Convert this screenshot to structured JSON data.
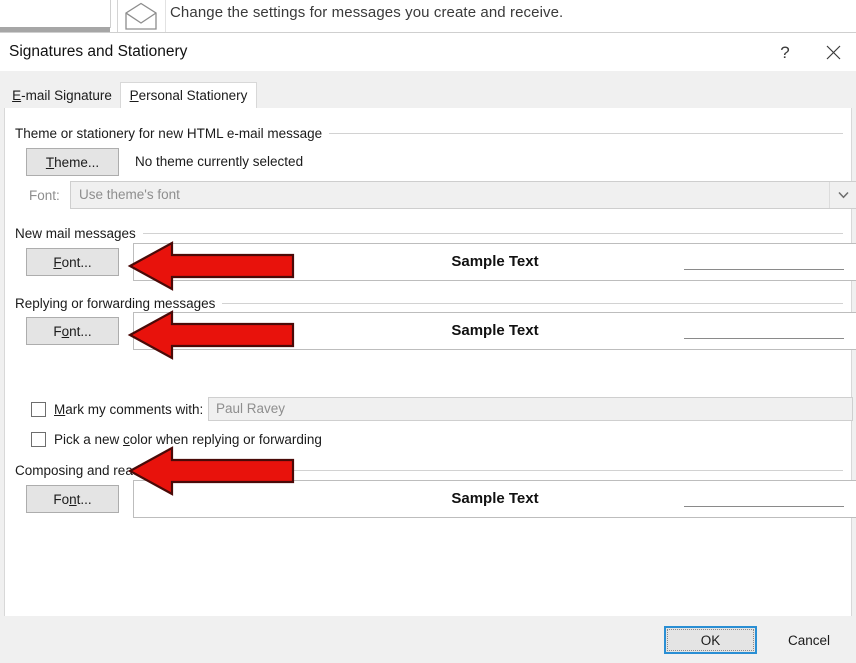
{
  "background": {
    "caption": "Change the settings for messages you create and receive.",
    "envelope_icon": "envelope-icon"
  },
  "dialog": {
    "title": "Signatures and Stationery",
    "help_glyph": "?",
    "close_glyph": "✕",
    "tabs": [
      {
        "label_pre": "",
        "accel": "E",
        "label_post": "-mail Signature",
        "active": false
      },
      {
        "label_pre": "",
        "accel": "P",
        "label_post": "ersonal Stationery",
        "active": true
      }
    ],
    "groups": {
      "theme": {
        "label": "Theme or stationery for new HTML e-mail message",
        "button_pre": "",
        "button_accel": "T",
        "button_post": "heme...",
        "status": "No theme currently selected",
        "font_label": "Font:",
        "font_value": "Use theme's font",
        "font_dropdown_icon": "chevron-down-icon"
      },
      "new_mail": {
        "label": "New mail messages",
        "button_pre": "",
        "button_accel": "F",
        "button_post": "ont...",
        "sample_text": "Sample Text"
      },
      "reply_forward": {
        "label": "Replying or forwarding messages",
        "button_pre": "F",
        "button_accel": "o",
        "button_post": "nt...",
        "sample_text": "Sample Text"
      },
      "plain_text": {
        "label": "Composing and reading plain text messages",
        "button_pre": "Fo",
        "button_accel": "n",
        "button_post": "t...",
        "sample_text": "Sample Text"
      }
    },
    "checkboxes": [
      {
        "label_pre": "",
        "accel": "M",
        "label_post": "ark my comments with:",
        "checked": false,
        "field_value": "Paul Ravey"
      },
      {
        "label_pre": "Pick a new ",
        "accel": "c",
        "label_post": "olor when replying or forwarding",
        "checked": false
      }
    ],
    "footer": {
      "ok_label": "OK",
      "cancel_label": "Cancel"
    }
  },
  "annotations": {
    "arrow_color": "#E8120C",
    "arrow_outline": "#4a0a08",
    "arrows": [
      {
        "name": "arrow-new-mail-font"
      },
      {
        "name": "arrow-reply-font"
      },
      {
        "name": "arrow-plain-text-font"
      }
    ]
  }
}
